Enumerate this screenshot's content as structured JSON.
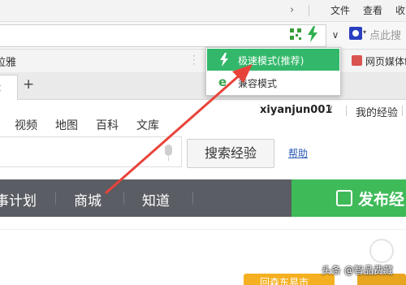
{
  "browser": {
    "menubar": {
      "collapse_glyph": "›",
      "items": [
        "文件",
        "查看",
        "收"
      ]
    },
    "addressbar": {
      "dropdown_glyph": "∨",
      "search_placeholder": "点此搜"
    },
    "bookmarks": {
      "left_label": "拉雅",
      "right_label": "网页媒体f"
    },
    "tabs": {
      "close_glyph": "×",
      "new_tab_glyph": "+"
    },
    "mode_popup": {
      "items": [
        {
          "label": "极速模式(推荐)",
          "icon": "lightning-icon",
          "active": true
        },
        {
          "label": "兼容模式",
          "icon": "ie-icon",
          "active": false
        }
      ],
      "ie_glyph": "e"
    }
  },
  "page": {
    "top_nav": [
      "视频",
      "地图",
      "百科",
      "文库"
    ],
    "user": {
      "name": "xiyanjun001",
      "dropdown_glyph": "∨",
      "my_experience": "我的经验"
    },
    "search": {
      "button_label": "搜索经验",
      "help_link": "帮助"
    },
    "dark_nav": {
      "items": [
        "事计划",
        "商城",
        "知道"
      ],
      "publish_label": "发布经"
    },
    "banner_text": "回森东易市",
    "watermark": "头条 @智品费藏"
  },
  "colors": {
    "popup_active": "#33b86b",
    "publish_green": "#3fba58",
    "dark_nav": "#5a5d63",
    "arrow_red": "#e8433a",
    "link_blue": "#2b58b5"
  }
}
